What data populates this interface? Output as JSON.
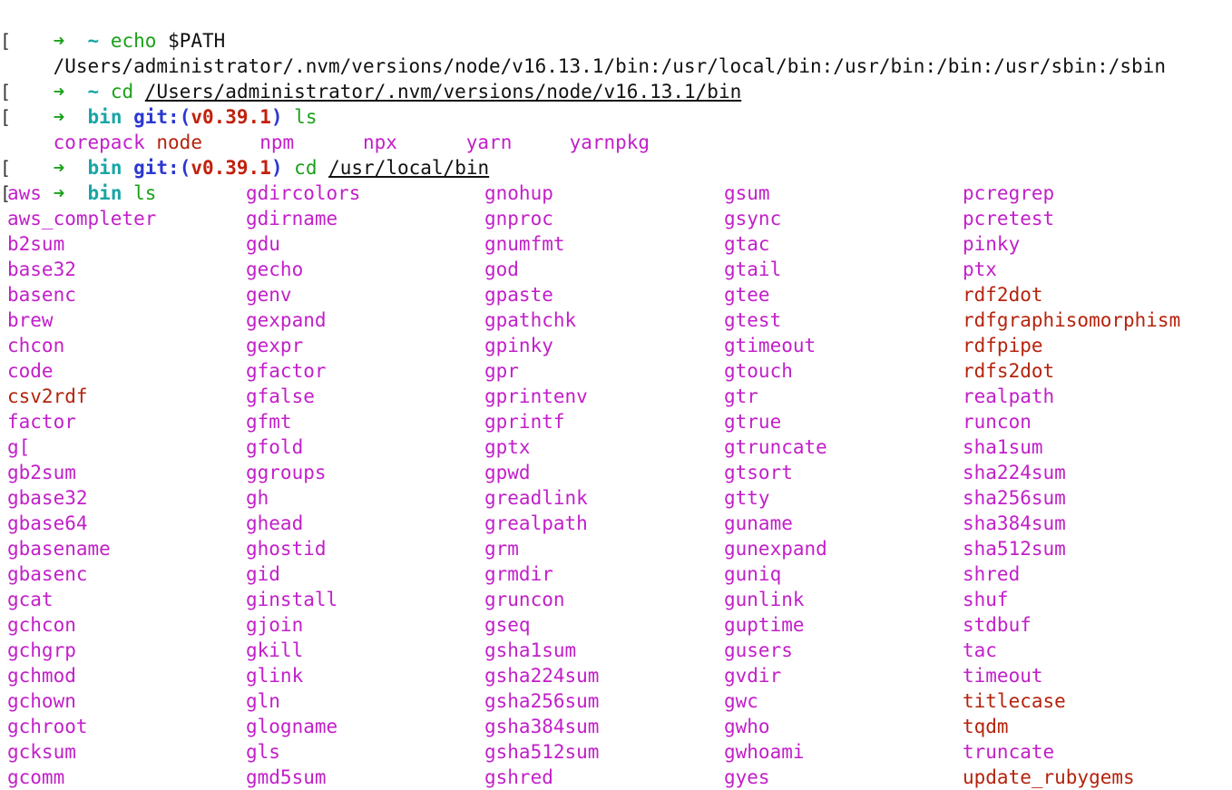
{
  "prompt": {
    "arrow": "➜",
    "tilde": "~",
    "bracket": "[",
    "dir_bin": "bin",
    "git_prefix": "git:(",
    "git_suffix": ")",
    "branch": "v0.39.1"
  },
  "lines": {
    "l1_cmd": "echo",
    "l1_arg": "$PATH",
    "l2_output": "/Users/administrator/.nvm/versions/node/v16.13.1/bin:/usr/local/bin:/usr/bin:/bin:/usr/sbin:/sbin",
    "l3_cmd": "cd",
    "l3_arg": "/Users/administrator/.nvm/versions/node/v16.13.1/bin",
    "l4_cmd": "ls",
    "l6_cmd": "cd",
    "l6_arg": "/usr/local/bin",
    "l7_cmd": "ls"
  },
  "nvm_bin_listing": [
    "corepack",
    "node",
    "npm",
    "npx",
    "yarn",
    "yarnpkg"
  ],
  "usr_local_bin_listing": {
    "columns": [
      [
        "aws",
        "aws_completer",
        "b2sum",
        "base32",
        "basenc",
        "brew",
        "chcon",
        "code",
        "csv2rdf",
        "factor",
        "g[",
        "gb2sum",
        "gbase32",
        "gbase64",
        "gbasename",
        "gbasenc",
        "gcat",
        "gchcon",
        "gchgrp",
        "gchmod",
        "gchown",
        "gchroot",
        "gcksum",
        "gcomm"
      ],
      [
        "gdircolors",
        "gdirname",
        "gdu",
        "gecho",
        "genv",
        "gexpand",
        "gexpr",
        "gfactor",
        "gfalse",
        "gfmt",
        "gfold",
        "ggroups",
        "gh",
        "ghead",
        "ghostid",
        "gid",
        "ginstall",
        "gjoin",
        "gkill",
        "glink",
        "gln",
        "glogname",
        "gls",
        "gmd5sum"
      ],
      [
        "gnohup",
        "gnproc",
        "gnumfmt",
        "god",
        "gpaste",
        "gpathchk",
        "gpinky",
        "gpr",
        "gprintenv",
        "gprintf",
        "gptx",
        "gpwd",
        "greadlink",
        "grealpath",
        "grm",
        "grmdir",
        "gruncon",
        "gseq",
        "gsha1sum",
        "gsha224sum",
        "gsha256sum",
        "gsha384sum",
        "gsha512sum",
        "gshred"
      ],
      [
        "gsum",
        "gsync",
        "gtac",
        "gtail",
        "gtee",
        "gtest",
        "gtimeout",
        "gtouch",
        "gtr",
        "gtrue",
        "gtruncate",
        "gtsort",
        "gtty",
        "guname",
        "gunexpand",
        "guniq",
        "gunlink",
        "guptime",
        "gusers",
        "gvdir",
        "gwc",
        "gwho",
        "gwhoami",
        "gyes"
      ],
      [
        "pcregrep",
        "pcretest",
        "pinky",
        "ptx",
        "rdf2dot",
        "rdfgraphisomorphism",
        "rdfpipe",
        "rdfs2dot",
        "realpath",
        "runcon",
        "sha1sum",
        "sha224sum",
        "sha256sum",
        "sha384sum",
        "sha512sum",
        "shred",
        "shuf",
        "stdbuf",
        "tac",
        "timeout",
        "titlecase",
        "tqdm",
        "truncate",
        "update_rubygems"
      ]
    ],
    "red_items": [
      "csv2rdf",
      "rdf2dot",
      "rdfgraphisomorphism",
      "rdfpipe",
      "rdfs2dot",
      "titlecase",
      "tqdm",
      "update_rubygems",
      "node"
    ]
  },
  "colors": {
    "executable": "#c21fc9",
    "red_script": "#b5230d",
    "prompt_arrow": "#1aa11a",
    "prompt_dir": "#18a6a6",
    "git_label": "#2b38d0",
    "branch": "#c2200c"
  }
}
